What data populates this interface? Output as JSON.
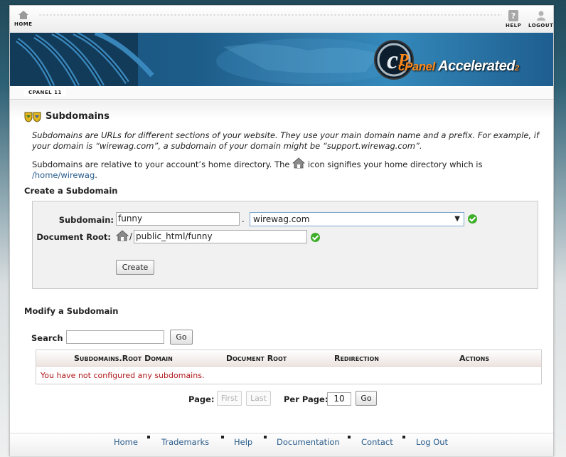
{
  "nav": {
    "home_label": "HOME",
    "help_label": "HELP",
    "logout_label": "LOGOUT"
  },
  "banner": {
    "brand": "cPanel",
    "product": "Accelerated",
    "version_sub": "2"
  },
  "breadcrumb": {
    "tab_label": "CPANEL 11"
  },
  "page": {
    "title": "Subdomains",
    "desc_line1": "Subdomains are URLs for different sections of your website. They use your main domain name and a prefix. For example, if",
    "desc_line2": "your domain is “wirewag.com”, a subdomain of your domain might be “support.wirewag.com”.",
    "home_line1_a": "Subdomains are relative to your account’s home directory. The",
    "home_line1_b": "icon signifies your home directory which is",
    "home_path": "/home/wirewag",
    "home_period": "."
  },
  "create": {
    "section_title": "Create a Subdomain",
    "subdomain_label": "Subdomain:",
    "subdomain_value": "funny",
    "dot": ".",
    "domain_selected": "wirewag.com",
    "docroot_label": "Document Root:",
    "docroot_prefix": "/",
    "docroot_value": "public_html/funny",
    "create_button": "Create"
  },
  "modify": {
    "section_title": "Modify a Subdomain",
    "search_label": "Search",
    "search_value": "",
    "go_button": "Go",
    "columns": [
      "Subdomains.Root Domain",
      "Document Root",
      "Redirection",
      "Actions"
    ],
    "empty_message": "You have not configured any subdomains."
  },
  "pagination": {
    "page_label": "Page:",
    "first_label": "First",
    "last_label": "Last",
    "per_page_label": "Per Page:",
    "per_page_value": "10",
    "go_button": "Go"
  },
  "footer": {
    "links": [
      "Home",
      "Trademarks",
      "Help",
      "Documentation",
      "Contact",
      "Log Out"
    ]
  },
  "colors": {
    "link": "#2b5d8c",
    "error": "#b0191c",
    "ok_check": "#3fae2a",
    "banner": "#1d5d8a"
  }
}
